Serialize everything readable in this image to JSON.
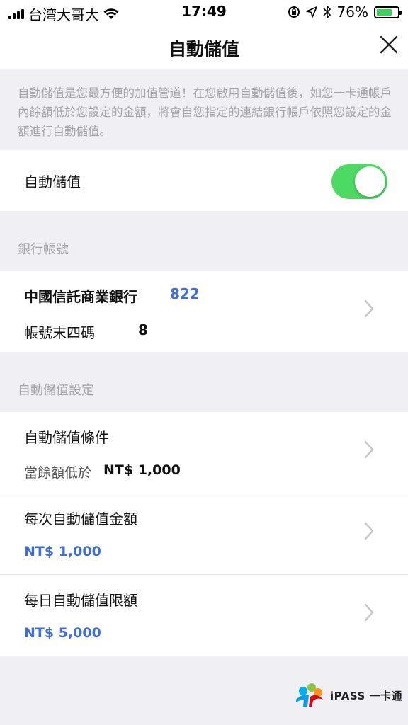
{
  "status": {
    "carrier": "台湾大哥大",
    "time": "17:49",
    "battery": "76%",
    "battery_level": 0.76
  },
  "nav": {
    "title": "自動儲值",
    "close_icon": "close-icon"
  },
  "description": "自動儲值是您最方便的加值管道！在您啟用自動儲值後，如您一卡通帳戶內餘額低於您設定的金額，將會自您指定的連結銀行帳戶依照您設定的金額進行自動儲值。",
  "toggle_row": {
    "label": "自動儲值",
    "enabled": true
  },
  "bank_section": {
    "header": "銀行帳號",
    "bank_name": "中國信託商業銀行",
    "bank_code": "822",
    "account_last4_label": "帳號末四碼",
    "account_last4_value": "8"
  },
  "settings_section": {
    "header": "自動儲值設定",
    "items": [
      {
        "title": "自動儲值條件",
        "sub_label": "當餘額低於",
        "sub_value": "NT$ 1,000"
      },
      {
        "title": "每次自動儲值金額",
        "sub_value": "NT$ 1,000"
      },
      {
        "title": "每日自動儲值限額",
        "sub_value": "NT$ 5,000"
      }
    ]
  },
  "logo": {
    "text": "iPASS 一卡通"
  },
  "colors": {
    "accent_blue": "#3f6ed8",
    "toggle_green": "#4cd964",
    "background": "#efeff4"
  }
}
